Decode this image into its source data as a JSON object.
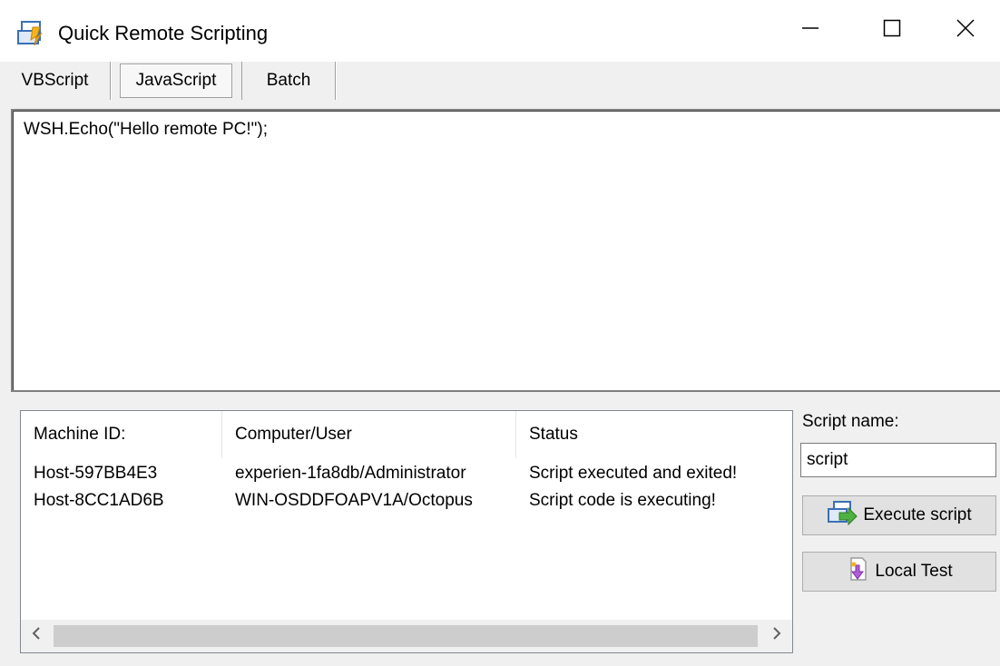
{
  "window": {
    "title": "Quick Remote Scripting",
    "icon": "script-app-icon",
    "controls": [
      "minimize-icon",
      "maximize-icon",
      "close-icon"
    ]
  },
  "tabs": [
    {
      "label": "VBScript",
      "selected": false
    },
    {
      "label": "JavaScript",
      "selected": true
    },
    {
      "label": "Batch",
      "selected": false
    }
  ],
  "editor": {
    "content": "WSH.Echo(\"Hello remote PC!\");"
  },
  "machines": {
    "columns": [
      "Machine ID:",
      "Computer/User",
      "Status"
    ],
    "rows": [
      [
        "Host-597BB4E3",
        "experien-1fa8db/Administrator",
        "Script executed and exited!"
      ],
      [
        "Host-8CC1AD6B",
        "WIN-OSDDFOAPV1A/Octopus",
        "Script code is executing!"
      ]
    ]
  },
  "panel": {
    "script_name_label": "Script name:",
    "script_name_value": "script",
    "execute_label": "Execute script",
    "local_test_label": "Local Test"
  }
}
